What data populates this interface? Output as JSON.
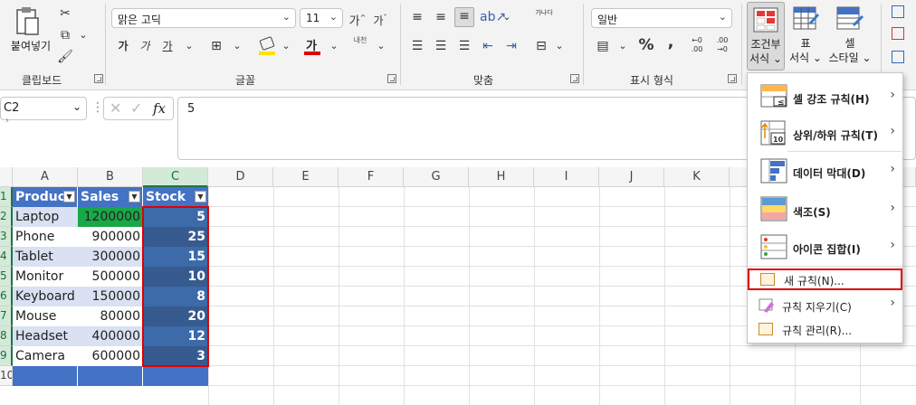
{
  "ribbon": {
    "clipboard": {
      "paste_label": "붙여넣기",
      "group_label": "클립보드"
    },
    "font": {
      "font_name": "맑은 고딕",
      "font_size": "11",
      "bold": "가",
      "italic": "가",
      "underline": "가",
      "font_color_glyph": "가",
      "phonetic_glyph": "내천",
      "group_label": "글꼴"
    },
    "alignment": {
      "wrap_glyph": "가나다",
      "group_label": "맞춤"
    },
    "number": {
      "format_value": "일반",
      "percent": "%",
      "comma": ",",
      "group_label": "표시 형식"
    },
    "styles": {
      "conditional_format_label_line1": "조건부",
      "conditional_format_label_line2": "서식",
      "format_table_label_line1": "표",
      "format_table_label_line2": "서식",
      "cell_styles_label_line1": "셀",
      "cell_styles_label_line2": "스타일"
    }
  },
  "formula_bar": {
    "name_box": "C2",
    "formula_value": "5",
    "fx": "fx"
  },
  "columns": [
    "A",
    "B",
    "C",
    "D",
    "E",
    "F",
    "G",
    "H",
    "I",
    "J",
    "K"
  ],
  "row_numbers": [
    "1",
    "2",
    "3",
    "4",
    "5",
    "6",
    "7",
    "8",
    "9",
    "10"
  ],
  "table": {
    "headers": [
      "Product",
      "Sales",
      "Stock"
    ],
    "rows": [
      {
        "product": "Laptop",
        "sales": "1200000",
        "stock": "5"
      },
      {
        "product": "Phone",
        "sales": "900000",
        "stock": "25"
      },
      {
        "product": "Tablet",
        "sales": "300000",
        "stock": "15"
      },
      {
        "product": "Monitor",
        "sales": "500000",
        "stock": "10"
      },
      {
        "product": "Keyboard",
        "sales": "150000",
        "stock": "8"
      },
      {
        "product": "Mouse",
        "sales": "80000",
        "stock": "20"
      },
      {
        "product": "Headset",
        "sales": "400000",
        "stock": "12"
      },
      {
        "product": "Camera",
        "sales": "600000",
        "stock": "3"
      }
    ]
  },
  "menu": {
    "items": [
      {
        "label": "셀 강조 규칙(H)",
        "icon": "highlight-cells-icon"
      },
      {
        "label": "상위/하위 규칙(T)",
        "icon": "top-bottom-icon"
      },
      {
        "label": "데이터 막대(D)",
        "icon": "data-bars-icon"
      },
      {
        "label": "색조(S)",
        "icon": "color-scales-icon"
      },
      {
        "label": "아이콘 집합(I)",
        "icon": "icon-sets-icon"
      }
    ],
    "new_rule": "새 규칙(N)...",
    "clear_rules": "규칙 지우기(C)",
    "manage_rules": "규칙 관리(R)..."
  },
  "colors": {
    "header_blue": "#4472c4",
    "band_light": "#d9e1f2",
    "band_mid": "#b4c6e7",
    "green_fill": "#18a848",
    "stock_dark": "#375a8f",
    "highlight_red": "#e00000",
    "excel_green": "#217346"
  }
}
